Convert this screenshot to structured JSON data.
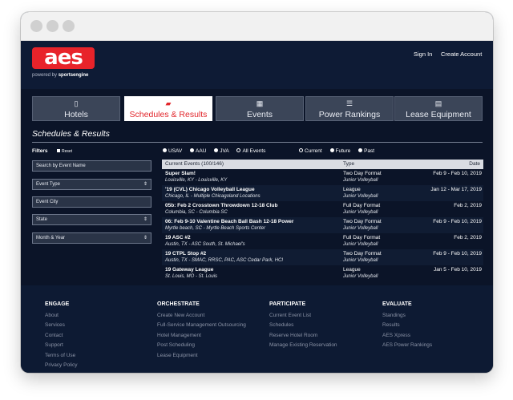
{
  "header": {
    "logo_text": "aes",
    "powered_prefix": "powered by",
    "powered_brand": "sportsengine",
    "sign_in": "Sign In",
    "create_account": "Create Account"
  },
  "tabs": [
    {
      "label": "Hotels",
      "icon": "hotel-icon",
      "glyph": "▯"
    },
    {
      "label": "Schedules & Results",
      "icon": "schedule-icon",
      "glyph": "▰"
    },
    {
      "label": "Events",
      "icon": "calendar-icon",
      "glyph": "▦"
    },
    {
      "label": "Power Rankings",
      "icon": "list-icon",
      "glyph": "☰"
    },
    {
      "label": "Lease Equipment",
      "icon": "document-icon",
      "glyph": "▤"
    }
  ],
  "page_title": "Schedules & Results",
  "filters": {
    "label": "Filters",
    "reset": "Reset",
    "search_placeholder": "Search by Event Name",
    "event_type": "Event Type",
    "event_city": "Event City",
    "state": "State",
    "month_year": "Month & Year"
  },
  "org_radios": [
    "USAV",
    "AAU",
    "JVA",
    "All Events"
  ],
  "time_radios": [
    "Current",
    "Future",
    "Past"
  ],
  "table": {
    "col_event": "Current Events (100/146)",
    "col_type": "Type",
    "col_date": "Date",
    "rows": [
      {
        "name": "Super Slam!",
        "loc": "Louisville, KY - Louisville, KY",
        "type": "Two Day Format",
        "sub": "Junior Volleyball",
        "date": "Feb 9 - Feb 10, 2019"
      },
      {
        "name": "'19 (CVL) Chicago Volleyball League",
        "loc": "Chicago, IL - Multiple Chicagoland Locations",
        "type": "League",
        "sub": "Junior Volleyball",
        "date": "Jan 12 - Mar 17, 2019"
      },
      {
        "name": "05b: Feb 2 Crosstown Throwdown 12-18 Club",
        "loc": "Columbia, SC - Columbia SC",
        "type": "Full Day Format",
        "sub": "Junior Volleyball",
        "date": "Feb 2, 2019"
      },
      {
        "name": "06: Feb 9-10 Valentine Beach Ball Bash 12-18 Power",
        "loc": "Myrtle beach, SC - Myrtle Beach Sports Center",
        "type": "Two Day Format",
        "sub": "Junior Volleyball",
        "date": "Feb 9 - Feb 10, 2019"
      },
      {
        "name": "19 ASC #2",
        "loc": "Austin, TX - ASC South, St. Michael's",
        "type": "Full Day Format",
        "sub": "Junior Volleyball",
        "date": "Feb 2, 2019"
      },
      {
        "name": "19 CTPL Stop #2",
        "loc": "Austin, TX - SMAC, RRSC, PAC, ASC Cedar Park, HCI",
        "type": "Two Day Format",
        "sub": "Junior Volleyball",
        "date": "Feb 9 - Feb 10, 2019"
      },
      {
        "name": "19 Gateway League",
        "loc": "St. Louis, MO - St. Louis",
        "type": "League",
        "sub": "Junior Volleyball",
        "date": "Jan 5 - Feb 10, 2019"
      }
    ]
  },
  "footer": {
    "engage": {
      "heading": "ENGAGE",
      "items": [
        "About",
        "Services",
        "Contact",
        "Support",
        "Terms of Use",
        "Privacy Policy"
      ]
    },
    "orchestrate": {
      "heading": "ORCHESTRATE",
      "items": [
        "Create New Account",
        "Full-Service Management Outsourcing",
        "Hotel Management",
        "Post Scheduling",
        "Lease Equipment"
      ]
    },
    "participate": {
      "heading": "PARTICIPATE",
      "items": [
        "Current Event List",
        "Schedules",
        "Reserve Hotel Room",
        "Manage Existing Reservation"
      ]
    },
    "evaluate": {
      "heading": "EVALUATE",
      "items": [
        "Standings",
        "Results",
        "AES Xpress",
        "AES Power Rankings"
      ]
    }
  },
  "colors": {
    "brand_red": "#e8232a",
    "navy": "#0d1a33",
    "tab_bg": "#3b4558"
  }
}
